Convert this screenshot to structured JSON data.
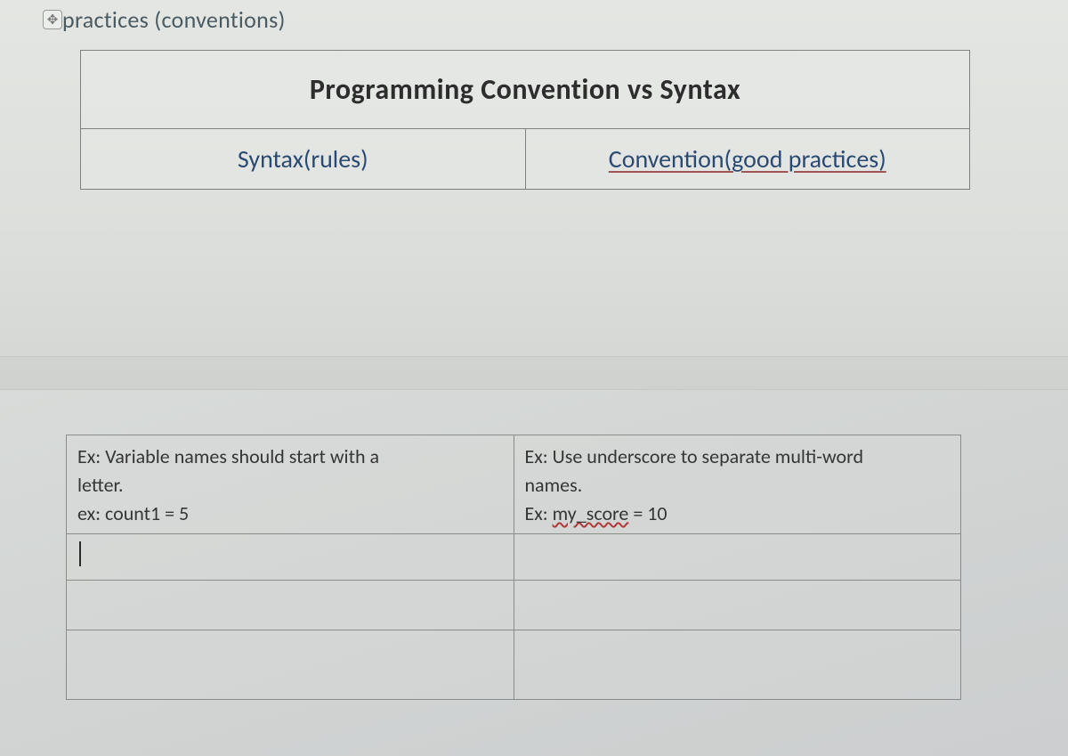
{
  "topFragment": {
    "handleGlyph": "✥",
    "text": "practices (conventions)"
  },
  "upperTable": {
    "title": "Programming Convention vs Syntax",
    "col1": "Syntax(rules)",
    "col2": "Convention(good practices)"
  },
  "lowerTable": {
    "row1": {
      "left": {
        "l1": "Ex: Variable names should start with a",
        "l2": "letter.",
        "l3": "ex: count1 = 5"
      },
      "right": {
        "l1": "Ex: Use underscore to separate multi-word",
        "l2": "names.",
        "l3_prefix": "Ex: ",
        "l3_code": "my_score",
        "l3_suffix": " = 10"
      }
    }
  }
}
